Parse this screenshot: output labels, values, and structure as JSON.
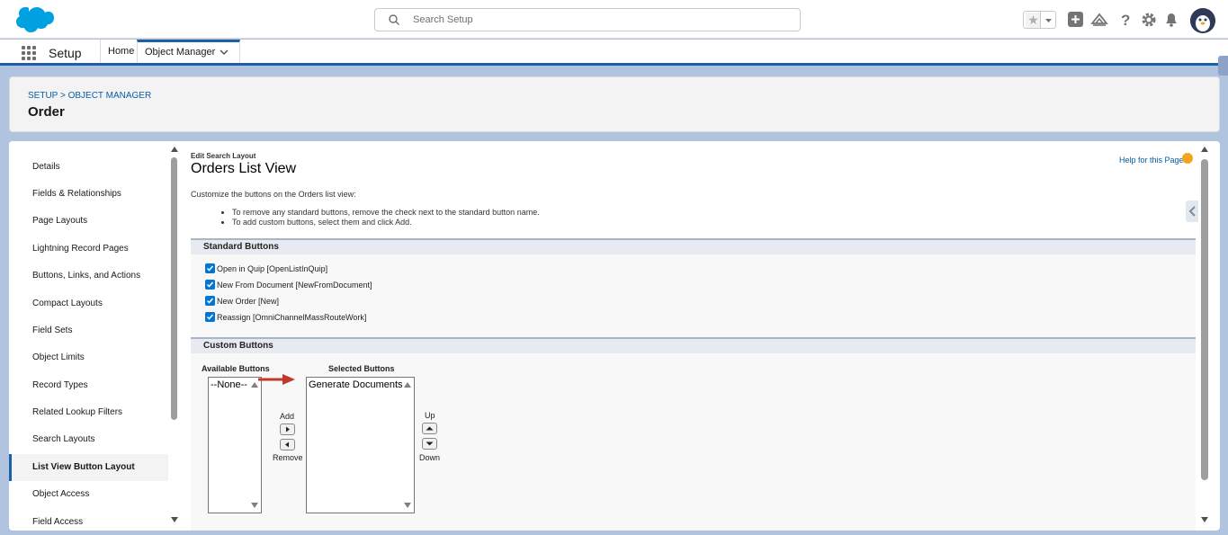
{
  "header": {
    "search_placeholder": "Search Setup",
    "brand_color": "#00a1e0"
  },
  "context": {
    "app_name": "Setup",
    "tabs": [
      {
        "label": "Home"
      },
      {
        "label": "Object Manager"
      }
    ]
  },
  "page": {
    "breadcrumb": [
      "SETUP",
      ">",
      "OBJECT MANAGER"
    ],
    "title": "Order"
  },
  "sidebar": {
    "items": [
      {
        "label": "Details"
      },
      {
        "label": "Fields & Relationships"
      },
      {
        "label": "Page Layouts"
      },
      {
        "label": "Lightning Record Pages"
      },
      {
        "label": "Buttons, Links, and Actions"
      },
      {
        "label": "Compact Layouts"
      },
      {
        "label": "Field Sets"
      },
      {
        "label": "Object Limits"
      },
      {
        "label": "Record Types"
      },
      {
        "label": "Related Lookup Filters"
      },
      {
        "label": "Search Layouts"
      },
      {
        "label": "List View Button Layout"
      },
      {
        "label": "Object Access"
      },
      {
        "label": "Field Access"
      }
    ],
    "active_item": "List View Button Layout"
  },
  "main": {
    "edit_label": "Edit Search Layout",
    "title": "Orders List View",
    "help_link": "Help for this Page",
    "intro": "Customize the buttons on the Orders list view:",
    "bullets": [
      "To remove any standard buttons, remove the check next to the standard button name.",
      "To add custom buttons, select them and click Add."
    ],
    "standard_section": {
      "title": "Standard Buttons",
      "buttons": [
        {
          "label": "Open in Quip [OpenListInQuip]",
          "checked": true
        },
        {
          "label": "New From Document [NewFromDocument]",
          "checked": true
        },
        {
          "label": "New Order [New]",
          "checked": true
        },
        {
          "label": "Reassign [OmniChannelMassRouteWork]",
          "checked": true
        }
      ]
    },
    "custom_section": {
      "title": "Custom Buttons",
      "available_label": "Available Buttons",
      "available_options": [
        "--None--"
      ],
      "selected_label": "Selected Buttons",
      "selected_options": [
        "Generate Documents"
      ],
      "add_label": "Add",
      "remove_label": "Remove",
      "up_label": "Up",
      "down_label": "Down"
    }
  }
}
